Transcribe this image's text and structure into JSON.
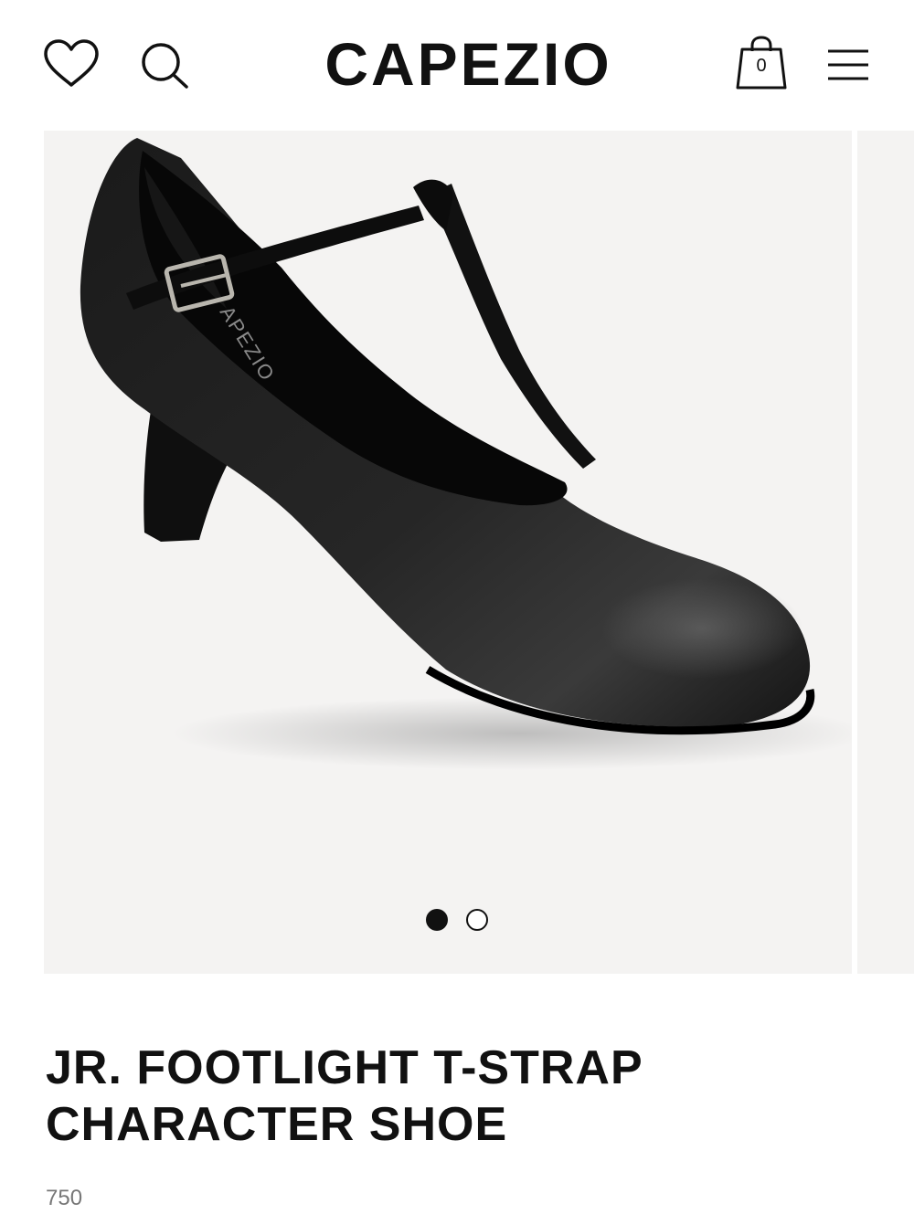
{
  "header": {
    "logo": "CAPEZIO",
    "cart_count": "0",
    "icons": [
      "heart-icon",
      "search-icon",
      "shopping-bag-icon",
      "hamburger-menu-icon"
    ]
  },
  "gallery": {
    "current_slide": 1,
    "total_slides": 2,
    "insole_brand_text": "APEZIO"
  },
  "product": {
    "title_line1": "JR. FOOTLIGHT T-STRAP",
    "title_line2": "CHARACTER SHOE",
    "sku": "750"
  },
  "colors": {
    "text": "#111111",
    "background": "#ffffff",
    "gallery_bg": "#f4f3f2",
    "sku_text": "#777777"
  }
}
